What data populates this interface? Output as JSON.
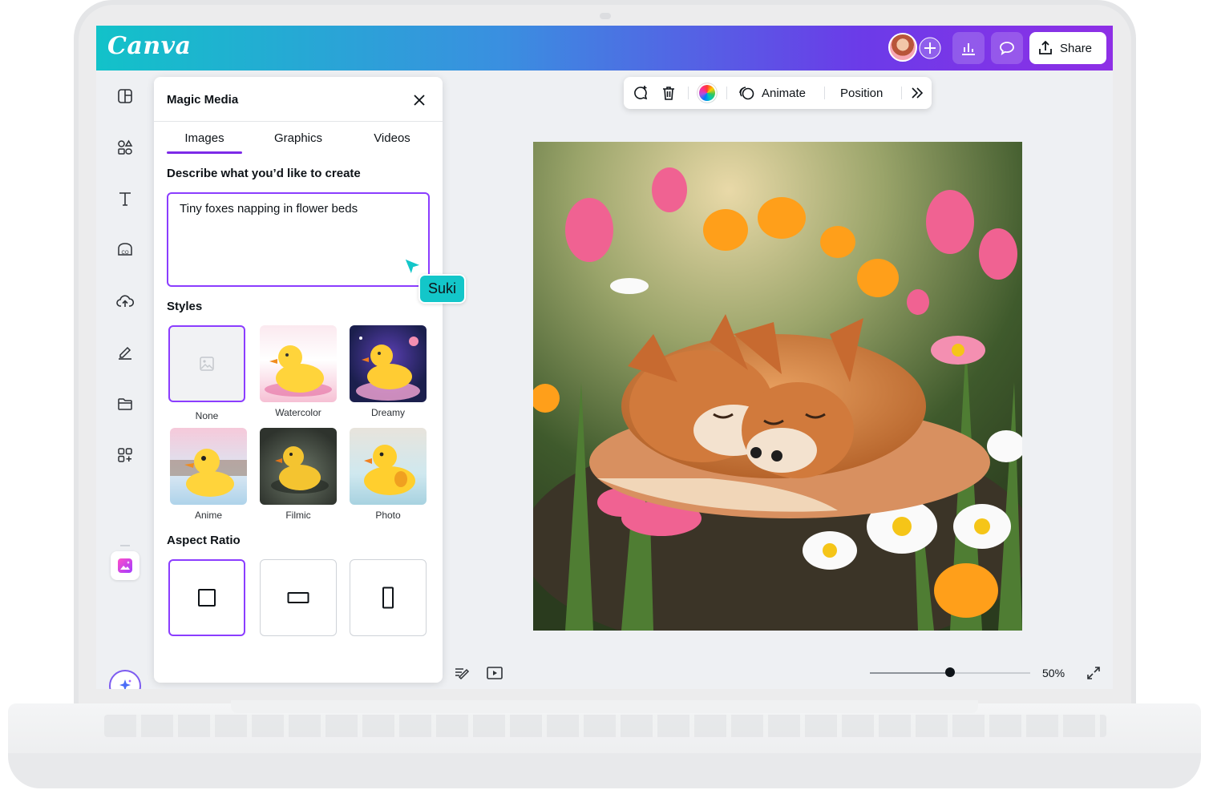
{
  "app": {
    "logo": "Canva"
  },
  "header": {
    "share_label": "Share",
    "icons": [
      "avatar",
      "add-icon",
      "analytics-icon",
      "comment-icon",
      "share-icon"
    ]
  },
  "rail": {
    "icons": [
      "design-icon",
      "elements-icon",
      "text-icon",
      "brand-icon",
      "uploads-icon",
      "draw-icon",
      "projects-icon",
      "apps-icon",
      "magic-media-icon",
      "magic-icon"
    ]
  },
  "panel": {
    "title": "Magic Media",
    "tabs": [
      {
        "label": "Images",
        "active": true
      },
      {
        "label": "Graphics",
        "active": false
      },
      {
        "label": "Videos",
        "active": false
      }
    ],
    "prompt_label": "Describe what you’d like to create",
    "prompt_value": "Tiny foxes napping in flower beds",
    "styles_label": "Styles",
    "styles": [
      {
        "label": "None",
        "selected": true
      },
      {
        "label": "Watercolor",
        "selected": false
      },
      {
        "label": "Dreamy",
        "selected": false
      },
      {
        "label": "Anime",
        "selected": false
      },
      {
        "label": "Filmic",
        "selected": false
      },
      {
        "label": "Photo",
        "selected": false
      }
    ],
    "aspect_label": "Aspect Ratio",
    "aspect_ratios": [
      {
        "shape": "square",
        "selected": true
      },
      {
        "shape": "landscape",
        "selected": false
      },
      {
        "shape": "portrait",
        "selected": false
      }
    ]
  },
  "collaborator": {
    "name": "Suki",
    "color": "#13c6c9"
  },
  "toolbar": {
    "animate_label": "Animate",
    "position_label": "Position"
  },
  "canvas": {
    "image_subject": "sleeping foxes among tulips and daisies"
  },
  "footer": {
    "zoom_label": "50%",
    "zoom_value": 50
  },
  "colors": {
    "accent": "#8b3dff",
    "header_gradient": [
      "#12c2c9",
      "#6b3be8",
      "#8e2fe6"
    ]
  }
}
